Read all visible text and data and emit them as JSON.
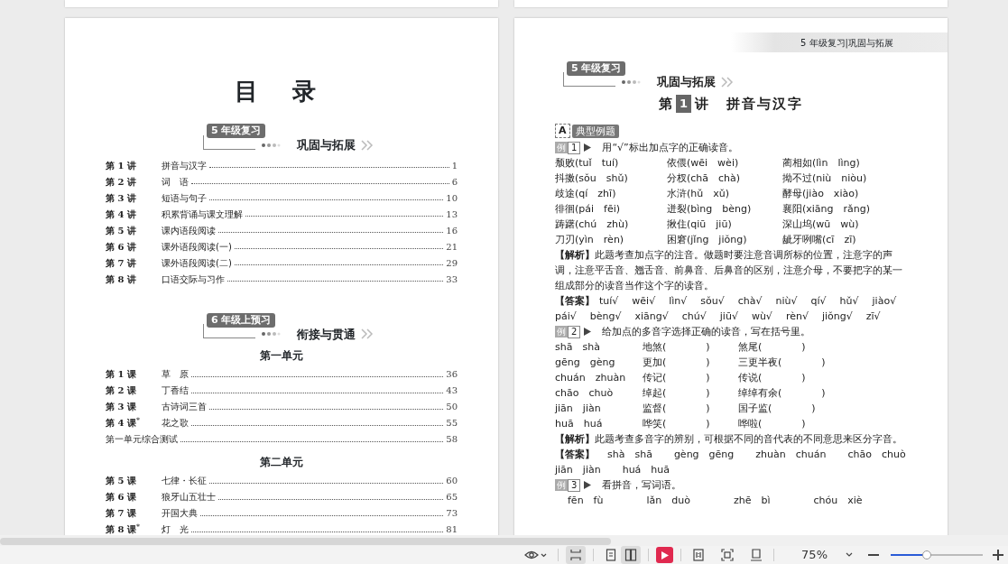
{
  "toc_page": {
    "title": "目 录",
    "sections": [
      {
        "badge": "5 年级复习",
        "heading": "巩固与拓展",
        "units": [
          {
            "entries": [
              {
                "number": "第 1 讲",
                "title": "拼音与汉字",
                "page": "1"
              },
              {
                "number": "第 2 讲",
                "title": "词　语",
                "page": "6"
              },
              {
                "number": "第 3 讲",
                "title": "短语与句子",
                "page": "10"
              },
              {
                "number": "第 4 讲",
                "title": "积累背诵与课文理解",
                "page": "13"
              },
              {
                "number": "第 5 讲",
                "title": "课内语段阅读",
                "page": "16"
              },
              {
                "number": "第 6 讲",
                "title": "课外语段阅读(一)",
                "page": "21"
              },
              {
                "number": "第 7 讲",
                "title": "课外语段阅读(二)",
                "page": "29"
              },
              {
                "number": "第 8 讲",
                "title": "口语交际与习作",
                "page": "33"
              }
            ]
          }
        ]
      },
      {
        "badge": "6 年级上预习",
        "heading": "衔接与贯通",
        "units": [
          {
            "title": "第一单元",
            "entries": [
              {
                "number": "第 1 课",
                "title": "草　原",
                "page": "36"
              },
              {
                "number": "第 2 课",
                "title": "丁香结",
                "page": "43"
              },
              {
                "number": "第 3 课",
                "title": "古诗词三首",
                "page": "50"
              },
              {
                "number": "第 4 课$^{*}$",
                "title": "花之歌",
                "page": "55"
              },
              {
                "title": "第一单元综合测试",
                "page": "58"
              }
            ]
          },
          {
            "title": "第二单元",
            "entries": [
              {
                "number": "第 5 课",
                "title": "七律・长征",
                "page": "60"
              },
              {
                "number": "第 6 课",
                "title": "狼牙山五壮士",
                "page": "65"
              },
              {
                "number": "第 7 课",
                "title": "开国大典",
                "page": "73"
              },
              {
                "number": "第 8 课$^{*}$",
                "title": "灯　光",
                "page": "81"
              }
            ]
          }
        ]
      }
    ]
  },
  "lesson_page": {
    "running_head": "5 年级复习|巩固与拓展",
    "badge": "5 年级复习",
    "heading": "巩固与拓展",
    "lesson": {
      "prefix": "第",
      "number": "1",
      "suffix": "讲",
      "title": "拼音与汉字"
    },
    "part": {
      "letter": "A",
      "label": "典型例题"
    },
    "examples": [
      {
        "kind": "choice",
        "tag": "例",
        "number": "1",
        "prompt": "用“√”标出加点字的正确读音。",
        "items": [
          "颓败(tuǐ　tuí)",
          "依偎(wēi　wèi)",
          "蔺相如(lìn　lìng)",
          "抖擞(sǒu　shǔ)",
          "分杈(chā　chà)",
          "拗不过(niù　niòu)",
          "歧途(qí　zhī)",
          "水浒(hǔ　xǔ)",
          "酵母(jiào　xiào)",
          "徘徊(pái　fēi)",
          "迸裂(bìng　bèng)",
          "襄阳(xiāng　rǎng)",
          "踌躇(chú　zhù)",
          "揪住(qiū　jiū)",
          "深山坞(wū　wù)",
          "刀刃(yìn　rèn)",
          "困窘(jǐng　jiǒng)",
          "龇牙咧嘴(cī　zī)"
        ],
        "analysis": "**【解析】**此题考查加点字的注音。做题时要注意音调所标的位置，注意字的声调，注意平舌音、翘舌音、前鼻音、后鼻音的区别，注意介母，不要把字的某一组成部分的读音当作这个字的读音。",
        "answer_label": "【答案】",
        "answers": [
          "tuí√",
          "wēi√",
          "lìn√",
          "sǒu√",
          "chà√",
          "niù√",
          "qí√",
          "hǔ√",
          "jiào√",
          "pái√",
          "bèng√",
          "xiāng√",
          "chú√",
          "jiū√",
          "wù√",
          "rèn√",
          "jiǒng√",
          "zī√"
        ]
      },
      {
        "kind": "fill",
        "tag": "例",
        "number": "2",
        "prompt": "给加点的多音字选择正确的读音，写在括号里。",
        "rows": [
          {
            "pinyin": "shā　shà",
            "first": "地煞(　　　　)",
            "second": "煞尾(　　　　)"
          },
          {
            "pinyin": "gēng　gèng",
            "first": "更加(　　　　)",
            "second": "三更半夜(　　　　)"
          },
          {
            "pinyin": "chuán　zhuàn",
            "first": "传记(　　　　)",
            "second": "传说(　　　　)"
          },
          {
            "pinyin": "chāo　chuò",
            "first": "绰起(　　　　)",
            "second": "绰绰有余(　　　　)"
          },
          {
            "pinyin": "jiān　jiàn",
            "first": "监督(　　　　)",
            "second": "国子监(　　　　)"
          },
          {
            "pinyin": "huā　huá",
            "first": "哗笑(　　　　)",
            "second": "哗啦(　　　　)"
          }
        ],
        "analysis": "**【解析】**此题考查多音字的辨别，可根据不同的音代表的不同意思来区分字音。",
        "answer_label": "【答案】",
        "answers": [
          "shà　shā",
          "gèng　gēng",
          "zhuàn　chuán",
          "chāo　chuò",
          "jiān　jiàn",
          "huá　huā"
        ]
      },
      {
        "kind": "write",
        "tag": "例",
        "number": "3",
        "prompt": "看拼音，写词语。",
        "pinyin": [
          "fēn　fù",
          "lǎn　duò",
          "zhē　bì",
          "chóu　xiè"
        ]
      }
    ]
  },
  "toolbar": {
    "layouts": [
      {
        "kind": "continuous",
        "selected": true
      },
      {
        "kind": "single",
        "selected": false
      },
      {
        "kind": "double",
        "selected": true
      }
    ],
    "zoom": "75%",
    "zoom_slider": {
      "level": 0.39
    }
  }
}
